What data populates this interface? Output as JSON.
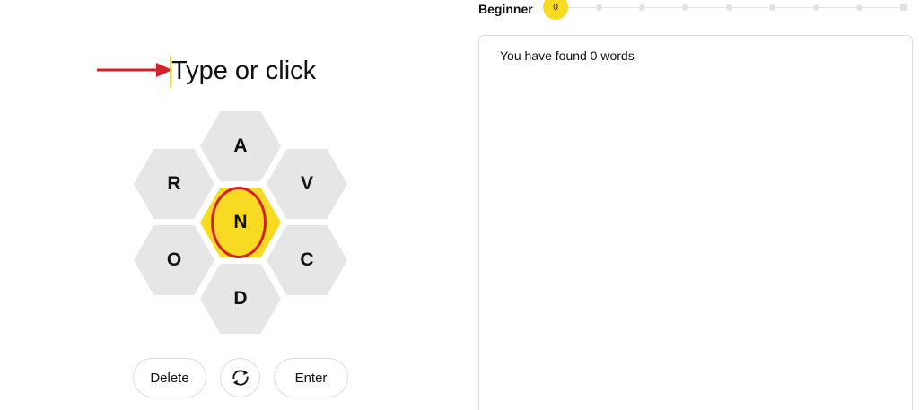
{
  "input": {
    "placeholder": "Type or click"
  },
  "hive": {
    "center_letter": "N",
    "outer_letters": {
      "top": "A",
      "upper_left": "R",
      "upper_right": "V",
      "lower_left": "O",
      "lower_right": "C",
      "bottom": "D"
    }
  },
  "controls": {
    "delete_label": "Delete",
    "shuffle_icon": "shuffle-icon",
    "enter_label": "Enter"
  },
  "progress": {
    "rank": "Beginner",
    "score": "0"
  },
  "wordlist": {
    "summary": "You have found 0 words"
  },
  "colors": {
    "accent_yellow": "#f7da21",
    "cell_gray": "#e6e6e6",
    "annotation_red": "#d42127"
  }
}
